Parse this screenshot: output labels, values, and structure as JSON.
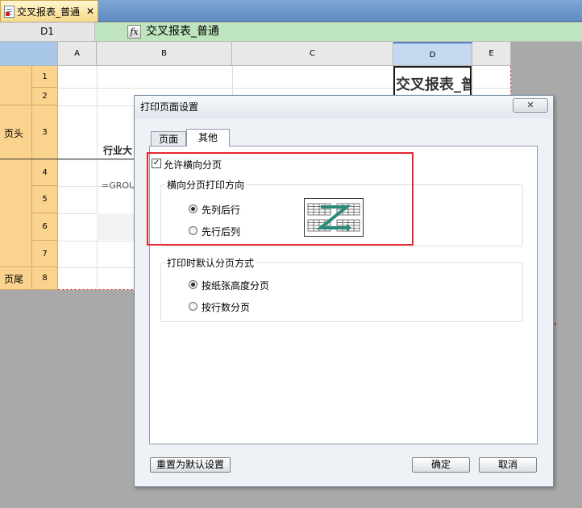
{
  "tab": {
    "title": "交叉报表_普通",
    "close": "✕"
  },
  "formula": {
    "cell_ref": "D1",
    "fx": "fx",
    "content": "交叉报表_普通"
  },
  "columns": [
    "A",
    "B",
    "C",
    "D",
    "E"
  ],
  "rows": [
    "1",
    "2",
    "3",
    "4",
    "5",
    "6",
    "7",
    "8"
  ],
  "sections": {
    "header": "页头",
    "footer": "页尾"
  },
  "cells": {
    "d1": "交叉报表_普",
    "b3_text": "行业大",
    "b5_text": "=GROU"
  },
  "dialog": {
    "title": "打印页面设置",
    "close": "✕",
    "tabs": {
      "page": "页面",
      "other": "其他"
    },
    "allow_horizontal": {
      "label": "允许横向分页",
      "checked": true,
      "mark": "✓"
    },
    "direction_group": {
      "title": "横向分页打印方向",
      "options": [
        {
          "label": "先列后行",
          "selected": true
        },
        {
          "label": "先行后列",
          "selected": false
        }
      ]
    },
    "default_group": {
      "title": "打印时默认分页方式",
      "options": [
        {
          "label": "按纸张高度分页",
          "selected": true
        },
        {
          "label": "按行数分页",
          "selected": false
        }
      ]
    },
    "buttons": {
      "reset": "重置为默认设置",
      "ok": "确定",
      "cancel": "取消"
    }
  },
  "colors": {
    "highlight": "#e8262d",
    "section_fill": "#fad38e",
    "formula_fill": "#bfe5bf"
  }
}
